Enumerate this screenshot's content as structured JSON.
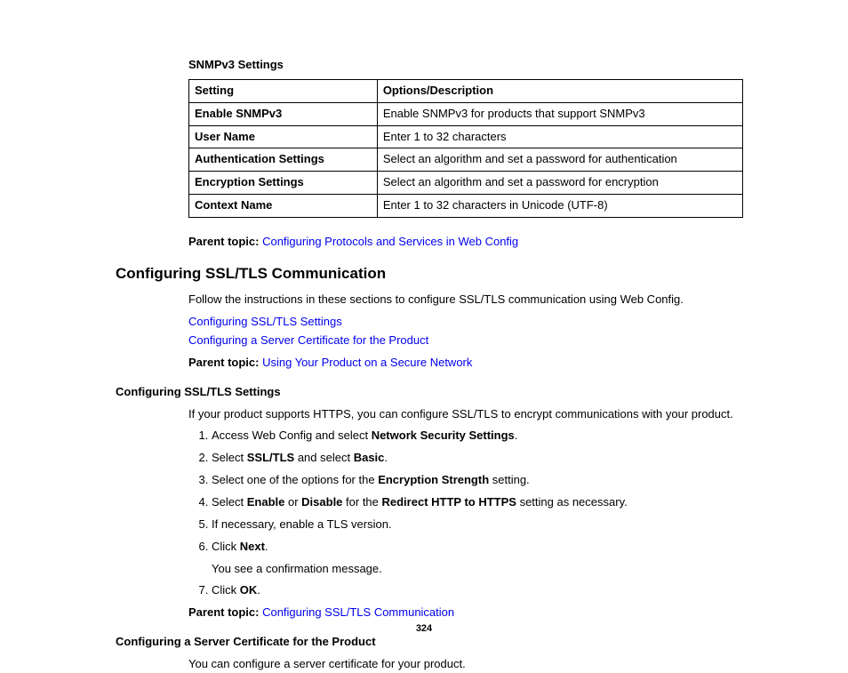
{
  "snmp": {
    "title": "SNMPv3 Settings",
    "headers": {
      "c1": "Setting",
      "c2": "Options/Description"
    },
    "rows": [
      {
        "setting": "Enable SNMPv3",
        "desc": "Enable SNMPv3 for products that support SNMPv3"
      },
      {
        "setting": "User Name",
        "desc": "Enter 1 to 32 characters"
      },
      {
        "setting": "Authentication Settings",
        "desc": "Select an algorithm and set a password for authentication"
      },
      {
        "setting": "Encryption Settings",
        "desc": "Select an algorithm and set a password for encryption"
      },
      {
        "setting": "Context Name",
        "desc": "Enter 1 to 32 characters in Unicode (UTF-8)"
      }
    ],
    "parent_label": "Parent topic: ",
    "parent_link": "Configuring Protocols and Services in Web Config"
  },
  "ssl": {
    "heading": "Configuring SSL/TLS Communication",
    "intro": "Follow the instructions in these sections to configure SSL/TLS communication using Web Config.",
    "links": {
      "l1": "Configuring SSL/TLS Settings",
      "l2": "Configuring a Server Certificate for the Product"
    },
    "parent_label": "Parent topic: ",
    "parent_link": "Using Your Product on a Secure Network"
  },
  "ssl_settings": {
    "heading": "Configuring SSL/TLS Settings",
    "intro": "If your product supports HTTPS, you can configure SSL/TLS to encrypt communications with your product.",
    "steps": {
      "s1a": "Access Web Config and select ",
      "s1b": "Network Security Settings",
      "s1c": ".",
      "s2a": "Select ",
      "s2b": "SSL/TLS",
      "s2c": " and select ",
      "s2d": "Basic",
      "s2e": ".",
      "s3a": "Select one of the options for the ",
      "s3b": "Encryption Strength",
      "s3c": " setting.",
      "s4a": "Select ",
      "s4b": "Enable",
      "s4c": " or ",
      "s4d": "Disable",
      "s4e": " for the ",
      "s4f": "Redirect HTTP to HTTPS",
      "s4g": " setting as necessary.",
      "s5": "If necessary, enable a TLS version.",
      "s6a": "Click ",
      "s6b": "Next",
      "s6c": ".",
      "s6_sub": "You see a confirmation message.",
      "s7a": "Click ",
      "s7b": "OK",
      "s7c": "."
    },
    "parent_label": "Parent topic: ",
    "parent_link": "Configuring SSL/TLS Communication"
  },
  "server_cert": {
    "heading": "Configuring a Server Certificate for the Product",
    "intro": "You can configure a server certificate for your product."
  },
  "page_number": "324"
}
